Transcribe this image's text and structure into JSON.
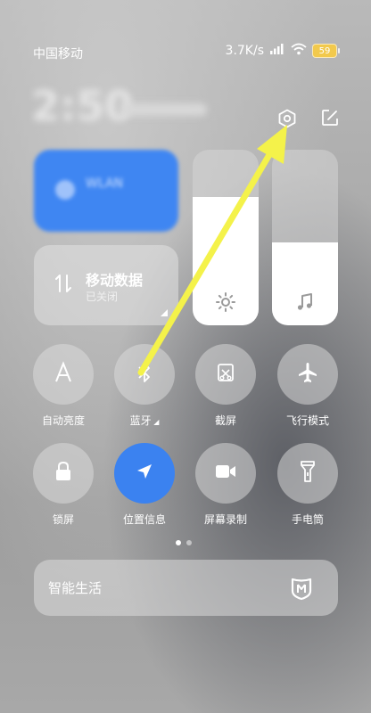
{
  "status_bar": {
    "carrier": "中国移动",
    "net_speed": "3.7K/s",
    "battery": "59"
  },
  "clock": {
    "time": "2:50"
  },
  "header_icons": [
    "settings-icon",
    "edit-icon"
  ],
  "tiles": {
    "wifi": {
      "title": "WLAN",
      "subtitle": ""
    },
    "mobile_data": {
      "title": "移动数据",
      "status": "已关闭"
    }
  },
  "sliders": {
    "brightness": {
      "icon": "sun-icon",
      "level": 0.73
    },
    "volume": {
      "icon": "music-note-icon",
      "level": 0.47
    }
  },
  "toggles": [
    {
      "label": "自动亮度",
      "icon": "auto-brightness-icon",
      "active": false
    },
    {
      "label": "蓝牙",
      "icon": "bluetooth-icon",
      "active": false
    },
    {
      "label": "截屏",
      "icon": "screenshot-icon",
      "active": false
    },
    {
      "label": "飞行模式",
      "icon": "airplane-icon",
      "active": false
    },
    {
      "label": "锁屏",
      "icon": "lock-icon",
      "active": false
    },
    {
      "label": "位置信息",
      "icon": "location-icon",
      "active": true
    },
    {
      "label": "屏幕录制",
      "icon": "video-camera-icon",
      "active": false
    },
    {
      "label": "手电筒",
      "icon": "flashlight-icon",
      "active": false
    }
  ],
  "pager": {
    "pages": 2,
    "current": 1
  },
  "smart_home": {
    "label": "智能生活",
    "icon": "mi-home-icon"
  },
  "colors": {
    "accent": "#3b82f0",
    "annotation_arrow": "#f4f24a"
  }
}
